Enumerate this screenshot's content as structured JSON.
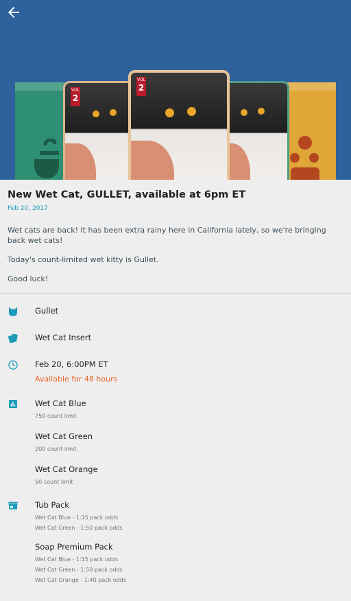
{
  "header": {
    "back_icon": "arrow-left-icon",
    "background_color": "#2d629d"
  },
  "article": {
    "title": "New Wet Cat, GULLET, available at 6pm ET",
    "date": "Feb 20, 2017",
    "paragraphs": [
      "Wet cats are back! It has been extra rainy here in California lately, so we're bringing back wet cats!",
      "Today's count-limited wet kitty is Gullet.",
      "Good luck!"
    ]
  },
  "hero_card": {
    "vol_label": "VOL",
    "vol_number": "2"
  },
  "details": {
    "name": "Gullet",
    "set": "Wet Cat Insert",
    "release_time": "Feb 20, 6:00PM ET",
    "availability": "Available for 48 hours",
    "variants": [
      {
        "name": "Wet Cat Blue",
        "limit": "750 count limit"
      },
      {
        "name": "Wet Cat Green",
        "limit": "200 count limit"
      },
      {
        "name": "Wet Cat Orange",
        "limit": "50 count limit"
      }
    ],
    "packs": [
      {
        "name": "Tub Pack",
        "odds": [
          "Wet Cat Blue - 1:15 pack odds",
          "Wet Cat Green - 1:50 pack odds"
        ]
      },
      {
        "name": "Soap Premium Pack",
        "odds": [
          "Wet Cat Blue - 1:15 pack odds",
          "Wet Cat Green - 1:50 pack odds",
          "Wet Cat Orange - 1:40 pack odds"
        ]
      }
    ]
  },
  "colors": {
    "accent": "#1a9bb9",
    "availability": "#e8672e"
  }
}
